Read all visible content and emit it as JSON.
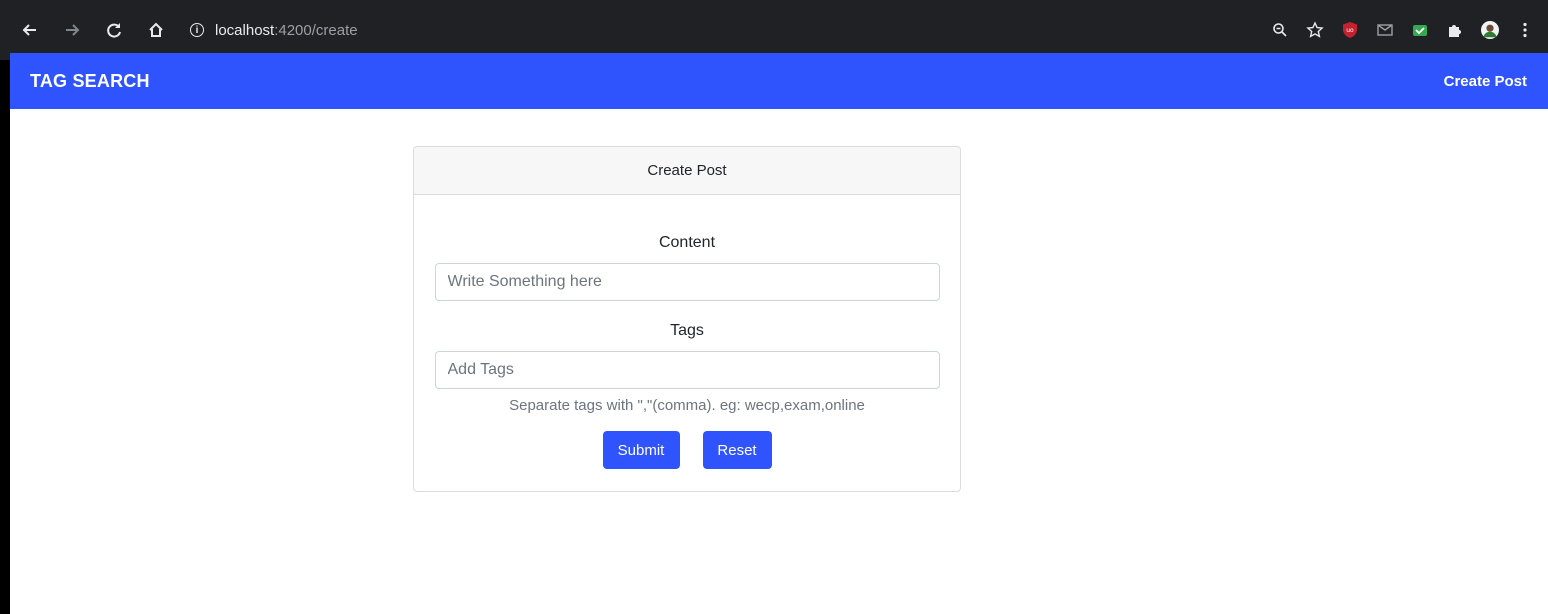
{
  "browser": {
    "url_host": "localhost",
    "url_path": ":4200/create",
    "icons": [
      "back-arrow-icon",
      "forward-arrow-icon",
      "reload-icon",
      "home-icon",
      "info-icon",
      "zoom-icon",
      "bookmark-star-icon",
      "ublock-icon",
      "mail-icon",
      "extension-icon",
      "puzzle-icon",
      "profile-avatar",
      "menu-dots-icon"
    ]
  },
  "navbar": {
    "brand": "TAG SEARCH",
    "create_link": "Create Post",
    "bg_color": "#2f54fd"
  },
  "card": {
    "header": "Create Post",
    "content_label": "Content",
    "content_value": "",
    "content_placeholder": "Write Something here",
    "tags_label": "Tags",
    "tags_value": "",
    "tags_placeholder": "Add Tags",
    "hint": "Separate tags with \",\"(comma). eg: wecp,exam,online",
    "submit_label": "Submit",
    "reset_label": "Reset"
  }
}
